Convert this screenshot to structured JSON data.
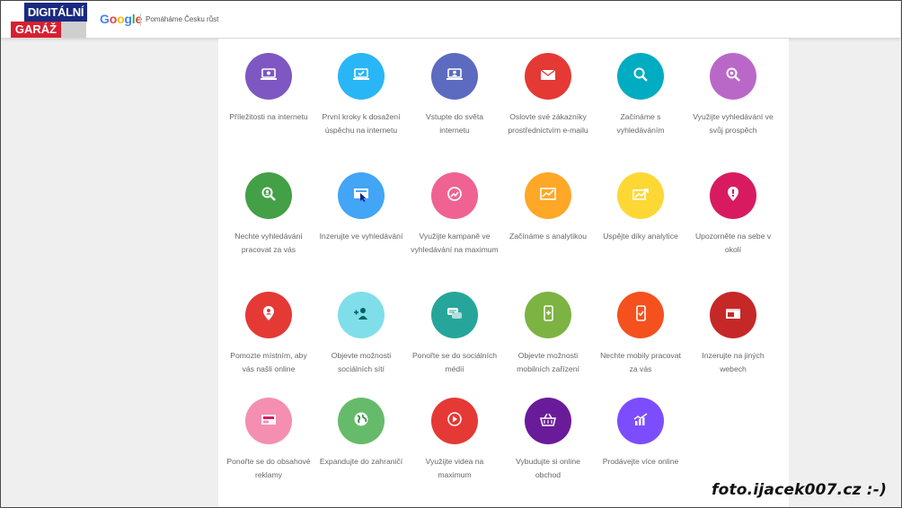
{
  "header": {
    "logo_top": "DIGITÁLNÍ",
    "logo_bottom": "GARÁŽ",
    "google_letters": [
      {
        "ch": "G",
        "color": "#4285F4"
      },
      {
        "ch": "o",
        "color": "#EA4335"
      },
      {
        "ch": "o",
        "color": "#FBBC05"
      },
      {
        "ch": "g",
        "color": "#4285F4"
      },
      {
        "ch": "l",
        "color": "#34A853"
      },
      {
        "ch": "e",
        "color": "#EA4335"
      }
    ],
    "tagline": "Pomáháme Česku růst"
  },
  "tiles": [
    {
      "label": "Příležitosti na internetu",
      "color": "#7e57c2",
      "icon": "laptop-icon"
    },
    {
      "label": "První kroky k dosažení úspěchu na internetu",
      "color": "#29b6f6",
      "icon": "laptop-check-icon"
    },
    {
      "label": "Vstupte do světa internetu",
      "color": "#5c6bc0",
      "icon": "laptop-person-icon"
    },
    {
      "label": "Oslovte své zákazníky prostřednictvím e-mailu",
      "color": "#e53935",
      "icon": "envelope-icon"
    },
    {
      "label": "Začínáme s vyhledáváním",
      "color": "#00acc1",
      "icon": "magnifier-icon"
    },
    {
      "label": "Využijte vyhledávání ve svůj prospěch",
      "color": "#ba68c8",
      "icon": "magnifier-gear-icon"
    },
    {
      "label": "Nechte vyhledávání pracovat za vás",
      "color": "#43a047",
      "icon": "magnifier-person-icon"
    },
    {
      "label": "Inzerujte ve vyhledávání",
      "color": "#42a5f5",
      "icon": "ad-cursor-icon"
    },
    {
      "label": "Využijte kampaně ve vyhledávání na maximum",
      "color": "#f06292",
      "icon": "chart-magnifier-icon"
    },
    {
      "label": "Začínáme s analytikou",
      "color": "#ffa726",
      "icon": "line-chart-icon"
    },
    {
      "label": "Uspějte díky analytice",
      "color": "#fdd835",
      "icon": "trend-up-icon"
    },
    {
      "label": "Upozorněte na sebe v okolí",
      "color": "#d81b60",
      "icon": "map-pin-alert-icon"
    },
    {
      "label": "Pomozte místním, aby vás našli online",
      "color": "#e53935",
      "icon": "map-pin-person-icon"
    },
    {
      "label": "Objevte možnosti sociálních sítí",
      "color": "#80deea",
      "icon": "add-person-icon"
    },
    {
      "label": "Ponořte se do sociálních médií",
      "color": "#26a69a",
      "icon": "chat-bubbles-icon"
    },
    {
      "label": "Objevte možnosti mobilních zařízení",
      "color": "#7cb342",
      "icon": "mobile-plus-icon"
    },
    {
      "label": "Nechte mobily pracovat za vás",
      "color": "#f4511e",
      "icon": "mobile-check-icon"
    },
    {
      "label": "Inzerujte na jiných webech",
      "color": "#c62828",
      "icon": "browser-ad-icon"
    },
    {
      "label": "Ponořte se do obsahové reklamy",
      "color": "#f48fb1",
      "icon": "display-ad-icon"
    },
    {
      "label": "Expandujte do zahraničí",
      "color": "#66bb6a",
      "icon": "globe-icon"
    },
    {
      "label": "Využijte videa na maximum",
      "color": "#e53935",
      "icon": "play-icon"
    },
    {
      "label": "Vybudujte si online obchod",
      "color": "#6a1b9a",
      "icon": "shopping-basket-icon"
    },
    {
      "label": "Prodávejte více online",
      "color": "#7c4dff",
      "icon": "bar-chart-up-icon"
    }
  ],
  "watermark": "foto.ijacek007.cz :-)"
}
